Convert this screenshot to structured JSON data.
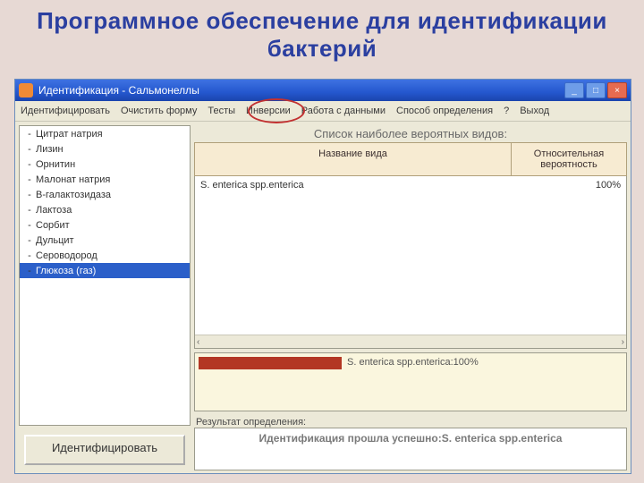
{
  "slide": {
    "title": "Программное обеспечение для идентификации бактерий"
  },
  "window": {
    "title": "Идентификация - Сальмонеллы",
    "btn_min": "_",
    "btn_max": "□",
    "btn_close": "×"
  },
  "menu": {
    "identify": "Идентифицировать",
    "clear": "Очистить форму",
    "tests": "Тесты",
    "inverse": "Инверсии",
    "data": "Работа с данными",
    "mode": "Способ определения",
    "help": "?",
    "exit": "Выход"
  },
  "tests": [
    {
      "chk": "-",
      "name": "Цитрат натрия"
    },
    {
      "chk": "-",
      "name": "Лизин"
    },
    {
      "chk": "-",
      "name": "Орнитин"
    },
    {
      "chk": "-",
      "name": "Малонат натрия"
    },
    {
      "chk": "-",
      "name": "В-галактозидаза"
    },
    {
      "chk": "-",
      "name": "Лактоза"
    },
    {
      "chk": "-",
      "name": "Сорбит"
    },
    {
      "chk": "-",
      "name": "Дульцит"
    },
    {
      "chk": "-",
      "name": "Сероводород"
    },
    {
      "chk": "-",
      "name": "Глюкоза (газ)"
    }
  ],
  "identify_button": "Идентифицировать",
  "right": {
    "heading": "Список наиболее вероятных видов:",
    "col_name": "Название вида",
    "col_prob": "Относительная вероятность",
    "row_name": "S. enterica spp.enterica",
    "row_prob": "100%",
    "scroll_l": "‹",
    "scroll_r": "›",
    "legend_text": "S. enterica spp.enterica:100%",
    "res_label": "Результат определения:",
    "res_text": "Идентификация прошла успешно:S. enterica spp.enterica"
  }
}
